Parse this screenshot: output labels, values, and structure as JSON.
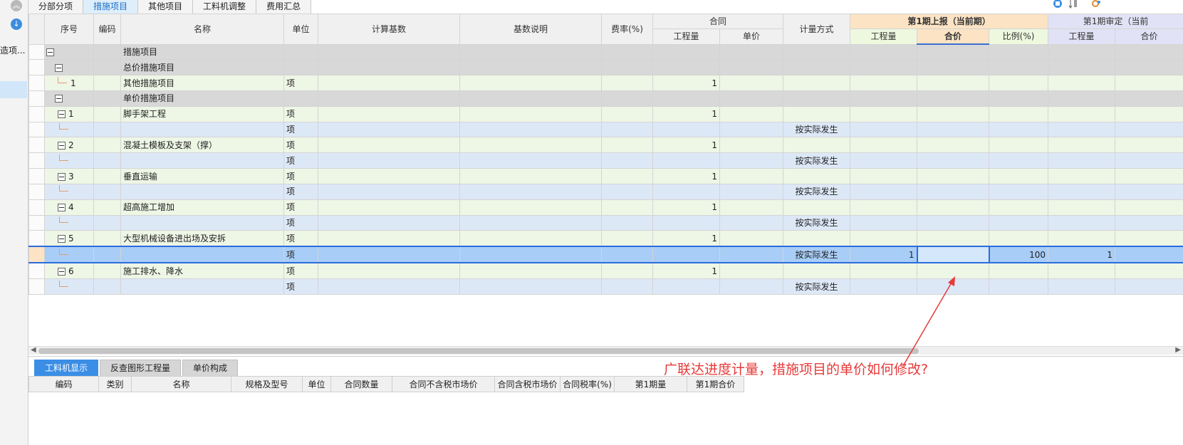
{
  "tabs": [
    "分部分项",
    "措施项目",
    "其他项目",
    "工料机调整",
    "费用汇总"
  ],
  "active_tab": 1,
  "left_panel": {
    "label": "造项..."
  },
  "grid": {
    "headers": {
      "seq": "序号",
      "code": "编码",
      "name": "名称",
      "unit": "单位",
      "calc_base": "计算基数",
      "base_desc": "基数说明",
      "rate": "费率(%)",
      "contract": "合同",
      "contract_qty": "工程量",
      "contract_price": "单价",
      "measure": "计量方式",
      "period1_report": "第1期上报（当前期）",
      "p1_qty": "工程量",
      "p1_total": "合价",
      "p1_ratio": "比例(%)",
      "period1_audit": "第1期审定（当前",
      "p2_qty": "工程量",
      "p2_total": "合价"
    },
    "rows": [
      {
        "kind": "g",
        "toggle": true,
        "level": 0,
        "seq": "",
        "name": "措施项目",
        "bold": true,
        "unit": "",
        "contract_qty": "",
        "measure": "",
        "p1_qty": "",
        "p1_ratio": "",
        "p2_qty": ""
      },
      {
        "kind": "g",
        "toggle": true,
        "level": 1,
        "seq": "",
        "name": "总价措施项目",
        "bold": false,
        "unit": "",
        "contract_qty": "",
        "measure": "",
        "p1_qty": "",
        "p1_ratio": "",
        "p2_qty": ""
      },
      {
        "kind": "gr",
        "toggle": false,
        "level": 2,
        "seq": "1",
        "name": "其他措施项目",
        "bold": false,
        "unit": "项",
        "contract_qty": "1",
        "measure": "",
        "p1_qty": "",
        "p1_ratio": "",
        "p2_qty": ""
      },
      {
        "kind": "g",
        "toggle": true,
        "level": 1,
        "seq": "",
        "name": "单价措施项目",
        "bold": false,
        "unit": "",
        "contract_qty": "",
        "measure": "",
        "p1_qty": "",
        "p1_ratio": "",
        "p2_qty": ""
      },
      {
        "kind": "gr",
        "toggle": true,
        "level": 2,
        "seq": "1",
        "name": "脚手架工程",
        "bold": false,
        "unit": "项",
        "contract_qty": "1",
        "measure": "",
        "p1_qty": "",
        "p1_ratio": "",
        "p2_qty": ""
      },
      {
        "kind": "bl",
        "toggle": false,
        "level": 3,
        "seq": "",
        "name": "",
        "bold": false,
        "unit": "项",
        "contract_qty": "",
        "measure": "按实际发生",
        "p1_qty": "",
        "p1_ratio": "",
        "p2_qty": ""
      },
      {
        "kind": "gr",
        "toggle": true,
        "level": 2,
        "seq": "2",
        "name": "混凝土模板及支架（撑）",
        "bold": false,
        "unit": "项",
        "contract_qty": "1",
        "measure": "",
        "p1_qty": "",
        "p1_ratio": "",
        "p2_qty": ""
      },
      {
        "kind": "bl",
        "toggle": false,
        "level": 3,
        "seq": "",
        "name": "",
        "bold": false,
        "unit": "项",
        "contract_qty": "",
        "measure": "按实际发生",
        "p1_qty": "",
        "p1_ratio": "",
        "p2_qty": ""
      },
      {
        "kind": "gr",
        "toggle": true,
        "level": 2,
        "seq": "3",
        "name": "垂直运输",
        "bold": false,
        "unit": "项",
        "contract_qty": "1",
        "measure": "",
        "p1_qty": "",
        "p1_ratio": "",
        "p2_qty": ""
      },
      {
        "kind": "bl",
        "toggle": false,
        "level": 3,
        "seq": "",
        "name": "",
        "bold": false,
        "unit": "项",
        "contract_qty": "",
        "measure": "按实际发生",
        "p1_qty": "",
        "p1_ratio": "",
        "p2_qty": ""
      },
      {
        "kind": "gr",
        "toggle": true,
        "level": 2,
        "seq": "4",
        "name": "超高施工增加",
        "bold": false,
        "unit": "项",
        "contract_qty": "1",
        "measure": "",
        "p1_qty": "",
        "p1_ratio": "",
        "p2_qty": ""
      },
      {
        "kind": "bl",
        "toggle": false,
        "level": 3,
        "seq": "",
        "name": "",
        "bold": false,
        "unit": "项",
        "contract_qty": "",
        "measure": "按实际发生",
        "p1_qty": "",
        "p1_ratio": "",
        "p2_qty": ""
      },
      {
        "kind": "gr",
        "toggle": true,
        "level": 2,
        "seq": "5",
        "name": "大型机械设备进出场及安拆",
        "bold": false,
        "unit": "项",
        "contract_qty": "1",
        "measure": "",
        "p1_qty": "",
        "p1_ratio": "",
        "p2_qty": ""
      },
      {
        "kind": "sel",
        "toggle": false,
        "level": 3,
        "seq": "",
        "name": "",
        "bold": false,
        "unit": "项",
        "contract_qty": "",
        "measure": "按实际发生",
        "p1_qty": "1",
        "p1_ratio": "100",
        "p2_qty": "1"
      },
      {
        "kind": "gr",
        "toggle": true,
        "level": 2,
        "seq": "6",
        "name": "施工排水、降水",
        "bold": false,
        "unit": "项",
        "contract_qty": "1",
        "measure": "",
        "p1_qty": "",
        "p1_ratio": "",
        "p2_qty": ""
      },
      {
        "kind": "bl",
        "toggle": false,
        "level": 3,
        "seq": "",
        "name": "",
        "bold": false,
        "unit": "项",
        "contract_qty": "",
        "measure": "按实际发生",
        "p1_qty": "",
        "p1_ratio": "",
        "p2_qty": ""
      }
    ]
  },
  "bottom_tabs": [
    "工料机显示",
    "反查图形工程量",
    "单价构成"
  ],
  "bottom_active": 0,
  "bottom_headers": [
    "编码",
    "类别",
    "名称",
    "规格及型号",
    "单位",
    "合同数量",
    "合同不含税市场价",
    "合同含税市场价",
    "合同税率(%)",
    "第1期量",
    "第1期合价"
  ],
  "annotation": {
    "question": "广联达进度计量，措施项目的单价如何修改?",
    "color": "#e83a3a"
  }
}
